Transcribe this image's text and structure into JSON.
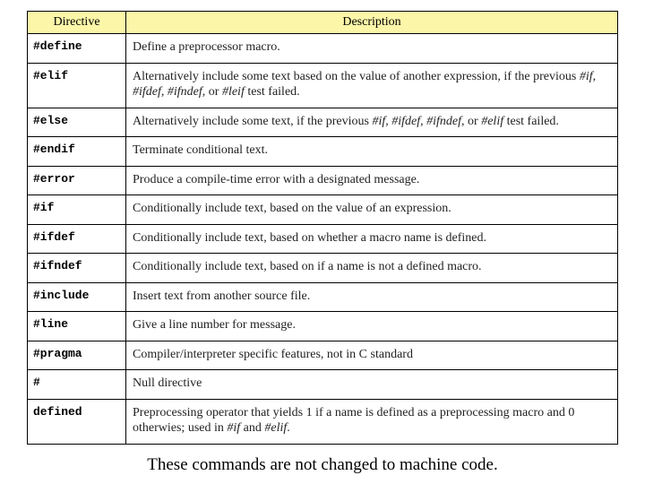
{
  "chart_data": {
    "type": "table",
    "columns": [
      "Directive",
      "Description"
    ],
    "rows": [
      [
        "#define",
        "Define a preprocessor macro."
      ],
      [
        "#elif",
        "Alternatively include some text based on the value of another expression, if the previous #if, #ifdef, #ifndef, or #leif test failed."
      ],
      [
        "#else",
        "Alternatively include some text, if the previous #if, #ifdef, #ifndef, or #elif test failed."
      ],
      [
        "#endif",
        "Terminate conditional text."
      ],
      [
        "#error",
        "Produce a compile-time error with a designated message."
      ],
      [
        "#if",
        "Conditionally include text, based on the value of an expression."
      ],
      [
        "#ifdef",
        "Conditionally include text, based on whether a macro name is defined."
      ],
      [
        "#ifndef",
        "Conditionally include text, based on if a name is not a defined macro."
      ],
      [
        "#include",
        "Insert text from another source file."
      ],
      [
        "#line",
        "Give a line number for message."
      ],
      [
        "#pragma",
        "Compiler/interpreter specific features, not in C standard"
      ],
      [
        "#",
        "Null directive"
      ],
      [
        "defined",
        "Preprocessing operator that yields 1 if a name is defined as a preprocessing macro and 0 otherwies; used in #if and #elif."
      ]
    ]
  },
  "header": {
    "col1": "Directive",
    "col2": "Description"
  },
  "rows": {
    "r0": {
      "dir": "#define",
      "desc_html": "Define a preprocessor macro."
    },
    "r1": {
      "dir": "#elif",
      "desc_html": "Alternatively include some text based on the value of another expression, if the previous <i>#if</i>, <i>#ifdef</i>, <i>#ifndef</i>, or <i>#leif</i> test failed."
    },
    "r2": {
      "dir": "#else",
      "desc_html": "Alternatively include some text, if the previous <i>#if</i>, <i>#ifdef</i>, <i>#ifndef</i>, or <i>#elif</i> test failed."
    },
    "r3": {
      "dir": "#endif",
      "desc_html": "Terminate conditional text."
    },
    "r4": {
      "dir": "#error",
      "desc_html": "Produce a compile-time error with a designated message."
    },
    "r5": {
      "dir": "#if",
      "desc_html": "Conditionally include text, based on the value of an expression."
    },
    "r6": {
      "dir": "#ifdef",
      "desc_html": "Conditionally include text, based on whether a macro name is defined."
    },
    "r7": {
      "dir": "#ifndef",
      "desc_html": "Conditionally include text, based on if a name is not a defined macro."
    },
    "r8": {
      "dir": "#include",
      "desc_html": "Insert text from another source file."
    },
    "r9": {
      "dir": "#line",
      "desc_html": "Give a line number for message."
    },
    "r10": {
      "dir": "#pragma",
      "desc_html": "Compiler/interpreter specific features, not in C standard"
    },
    "r11": {
      "dir": "#",
      "desc_html": "Null directive"
    },
    "r12": {
      "dir": "defined",
      "desc_html": "Preprocessing operator that yields 1 if a name is defined as a preprocessing macro and 0 otherwies; used in <i>#if</i> and <i>#elif</i>."
    }
  },
  "caption": "These commands are not changed to machine code."
}
